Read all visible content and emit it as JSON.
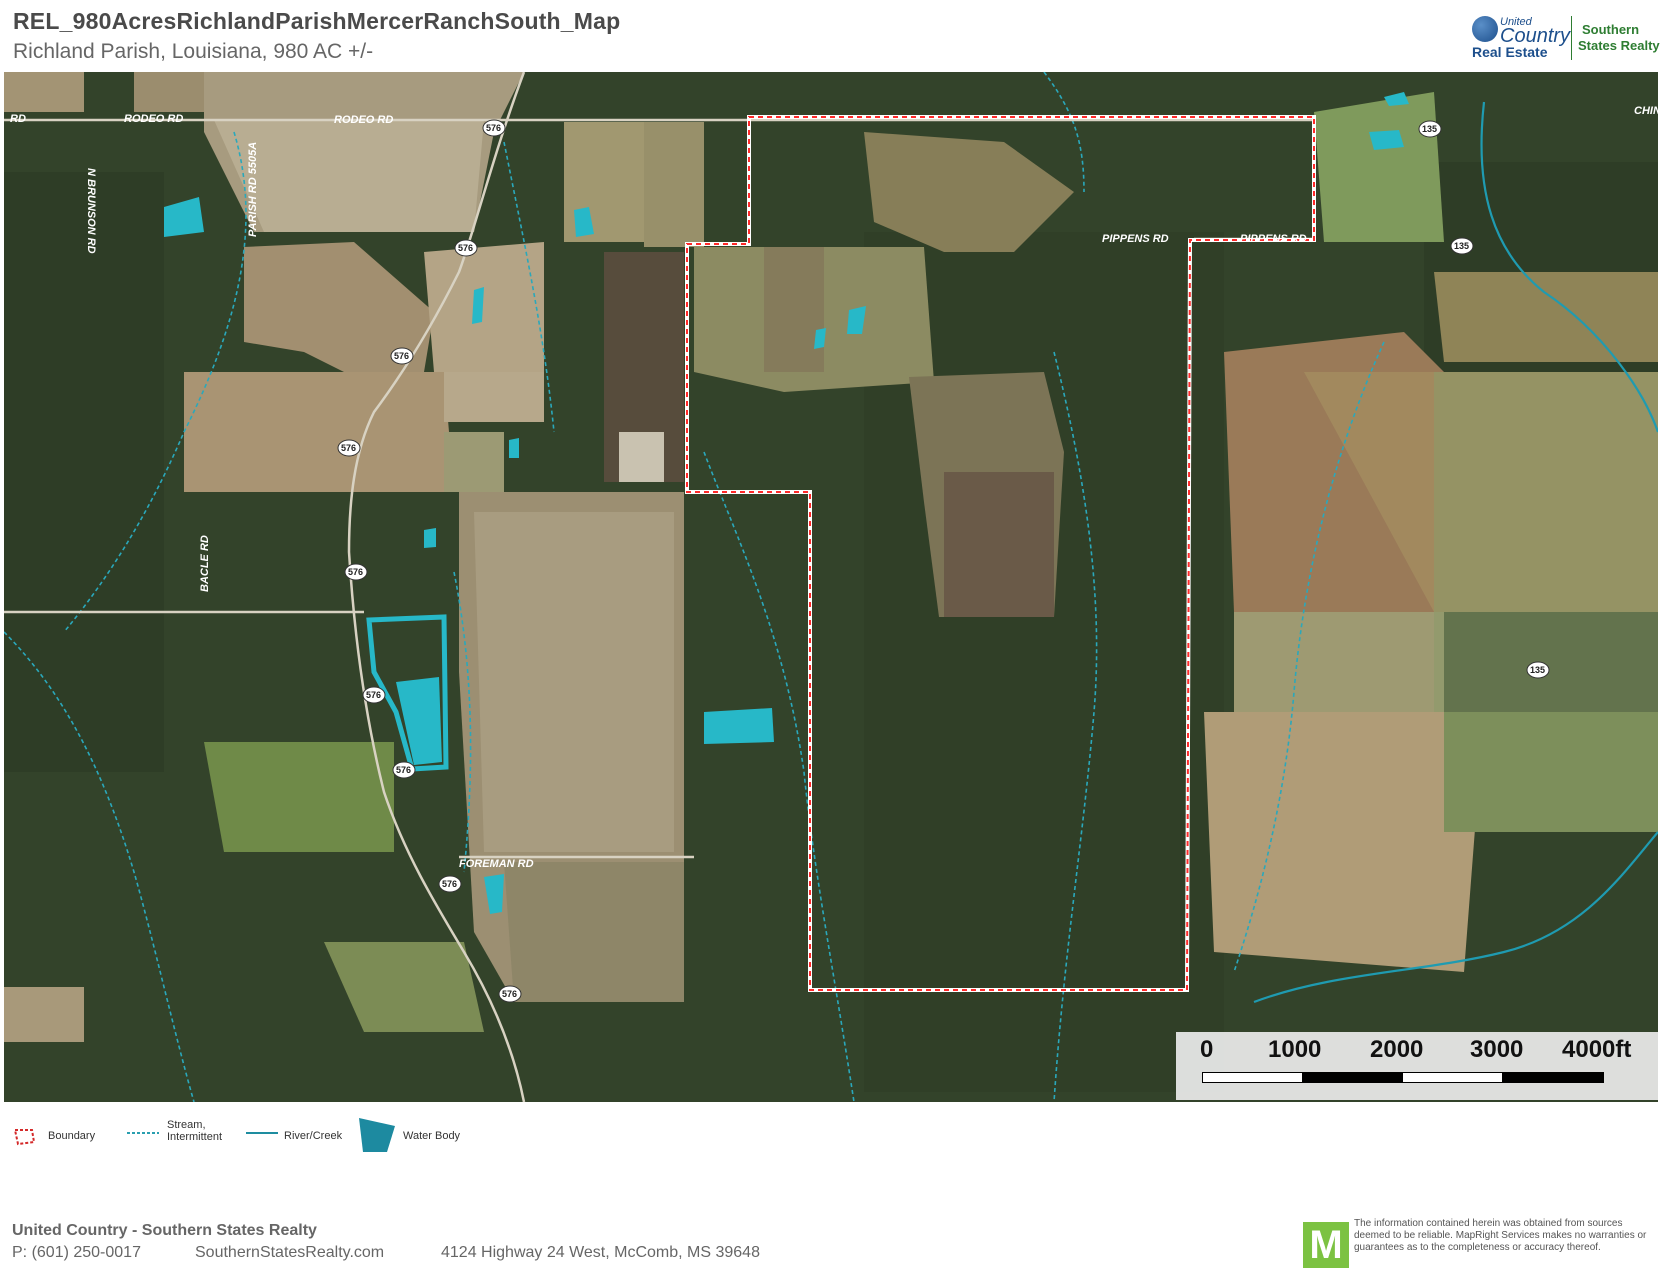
{
  "header": {
    "title": "REL_980AcresRichlandParishMercerRanchSouth_Map",
    "subtitle": "Richland Parish, Louisiana, 980 AC +/-"
  },
  "brand": {
    "uc_small": "United",
    "uc_large": "Country",
    "real_estate": "Real Estate",
    "ss_line1": "Southern",
    "ss_line2": "States Realty"
  },
  "map": {
    "roads": [
      {
        "id": "rodeo-rd-west",
        "label": "RD"
      },
      {
        "id": "rodeo-rd-1",
        "label": "RODEO RD"
      },
      {
        "id": "rodeo-rd-2",
        "label": "RODEO RD"
      },
      {
        "id": "n-brunson-rd",
        "label": "N BRUNSON RD"
      },
      {
        "id": "parish-rd-5505a",
        "label": "PARISH RD 5505A"
      },
      {
        "id": "pippens-rd-1",
        "label": "PIPPENS RD"
      },
      {
        "id": "pippens-rd-2",
        "label": "PIPPENS RD"
      },
      {
        "id": "bacle-rd",
        "label": "BACLE RD"
      },
      {
        "id": "foreman-rd",
        "label": "FOREMAN RD"
      },
      {
        "id": "chin-edge",
        "label": "CHIN"
      }
    ],
    "shields": [
      "576",
      "576",
      "576",
      "576",
      "576",
      "576",
      "576",
      "576",
      "576",
      "135",
      "135",
      "135"
    ]
  },
  "scale": {
    "ticks": [
      "0",
      "1000",
      "2000",
      "3000",
      "4000ft"
    ],
    "colors": [
      "#ffffff",
      "#000000",
      "#ffffff",
      "#000000"
    ]
  },
  "legend": [
    {
      "id": "boundary",
      "label": "Boundary",
      "icon": "boundary-icon",
      "color": "#d42a2a"
    },
    {
      "id": "stream",
      "label": "Stream, Intermittent",
      "line1": "Stream,",
      "line2": "Intermittent",
      "icon": "stream-line-icon",
      "color": "#2a9fb0"
    },
    {
      "id": "river",
      "label": "River/Creek",
      "icon": "river-line-icon",
      "color": "#1e8da0"
    },
    {
      "id": "water",
      "label": "Water Body",
      "icon": "water-body-icon",
      "color": "#1d8aa0"
    }
  ],
  "footer": {
    "company": "United Country - Southern States Realty",
    "phone": "P: (601) 250-0017",
    "website": "SouthernStatesRealty.com",
    "address": "4124 Highway 24 West, McComb, MS 39648",
    "m_logo": "M",
    "disclaimer": "The information contained herein was obtained from sources deemed to be reliable. MapRight Services makes no warranties or guarantees as to the completeness or accuracy thereof."
  },
  "colors": {
    "forest": "#2f3f22",
    "field_tan": "#a99a78",
    "pasture": "#7e8a55",
    "water": "#27b8c8",
    "boundary": "#ff2a2a"
  }
}
